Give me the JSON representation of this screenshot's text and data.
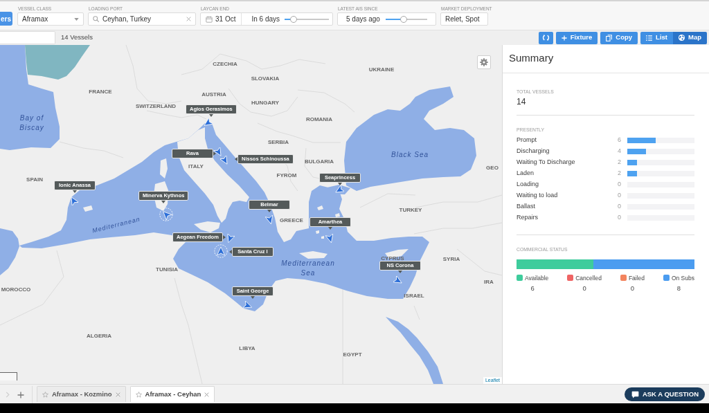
{
  "filters": {
    "toggle": {
      "label": "ers"
    },
    "vessel_class": {
      "label": "VESSEL CLASS",
      "value": "Aframax"
    },
    "loading_port": {
      "label": "LOADING PORT",
      "value": "Ceyhan, Turkey"
    },
    "laycan_end": {
      "label": "LAYCAN END",
      "date": "31 Oct",
      "relative": "In 6 days",
      "level": 0.2
    },
    "latest_ais": {
      "label": "LATEST AIS SINCE",
      "value": "5 days ago",
      "level": 0.44
    },
    "market_deployment": {
      "label": "MARKET DEPLOYMENT",
      "value": "Relet, Spot"
    }
  },
  "toolbar": {
    "vessel_count": "14 Vessels",
    "actions": [
      {
        "kind": "refresh"
      },
      {
        "kind": "add",
        "label": "Fixture"
      },
      {
        "kind": "copy",
        "label": "Copy"
      }
    ],
    "views": [
      {
        "kind": "list",
        "label": "List",
        "selected": false
      },
      {
        "kind": "map",
        "label": "Map",
        "selected": true
      }
    ]
  },
  "map": {
    "labels": [
      {
        "text": "CZECHIA",
        "kind": "country"
      },
      {
        "text": "UKRAINE",
        "kind": "country"
      },
      {
        "text": "SLOVAKIA",
        "kind": "country"
      },
      {
        "text": "FRANCE",
        "kind": "country"
      },
      {
        "text": "AUSTRIA",
        "kind": "country"
      },
      {
        "text": "HUNGARY",
        "kind": "country"
      },
      {
        "text": "SWITZERLAND",
        "kind": "country"
      },
      {
        "text": "Bay of Biscay",
        "kind": "sea"
      },
      {
        "text": "ROMANIA",
        "kind": "country"
      },
      {
        "text": "SERBIA",
        "kind": "country"
      },
      {
        "text": "ITALY",
        "kind": "country"
      },
      {
        "text": "BULGARIA",
        "kind": "country"
      },
      {
        "text": "Black Sea",
        "kind": "sea"
      },
      {
        "text": "FYROM",
        "kind": "country"
      },
      {
        "text": "GEO",
        "kind": "country"
      },
      {
        "text": "SPAIN",
        "kind": "country"
      },
      {
        "text": "TURKEY",
        "kind": "country"
      },
      {
        "text": "GREECE",
        "kind": "country"
      },
      {
        "text": "Mediterranean",
        "kind": "sea"
      },
      {
        "text": "TUNISIA",
        "kind": "country"
      },
      {
        "text": "Mediterranean Sea",
        "kind": "sea"
      },
      {
        "text": "SYRIA",
        "kind": "country"
      },
      {
        "text": "CYPRUS",
        "kind": "country"
      },
      {
        "text": "MOROCCO",
        "kind": "country"
      },
      {
        "text": "ISRAEL",
        "kind": "country"
      },
      {
        "text": "IRA",
        "kind": "country"
      },
      {
        "text": "ALGERIA",
        "kind": "country"
      },
      {
        "text": "LIBYA",
        "kind": "country"
      },
      {
        "text": "EGYPT",
        "kind": "country"
      }
    ],
    "vessels": [
      {
        "name": "Agios Gerasimos",
        "highlighted": false
      },
      {
        "name": "Rava",
        "highlighted": false
      },
      {
        "name": "Nissos Schinoussa",
        "highlighted": false
      },
      {
        "name": "Seaprincess",
        "highlighted": false
      },
      {
        "name": "Ionic Anassa",
        "highlighted": false
      },
      {
        "name": "Minerva Kythnos",
        "highlighted": true
      },
      {
        "name": "Belmar",
        "highlighted": false
      },
      {
        "name": "Amarthea",
        "highlighted": false
      },
      {
        "name": "Aegean Freedom",
        "highlighted": false
      },
      {
        "name": "Santa Cruz I",
        "highlighted": true
      },
      {
        "name": "NS Corona",
        "highlighted": false
      },
      {
        "name": "Saint George",
        "highlighted": false
      }
    ],
    "attribution": "Leaflet"
  },
  "summary": {
    "title": "Summary",
    "total_label": "TOTAL VESSELS",
    "total": "14",
    "presently_label": "PRESENTLY",
    "presently": [
      {
        "name": "Prompt",
        "count": "6",
        "level": 0.42
      },
      {
        "name": "Discharging",
        "count": "4",
        "level": 0.28
      },
      {
        "name": "Waiting To Discharge",
        "count": "2",
        "level": 0.14
      },
      {
        "name": "Laden",
        "count": "2",
        "level": 0.14
      },
      {
        "name": "Loading",
        "count": "0"
      },
      {
        "name": "Waiting to load",
        "count": "0"
      },
      {
        "name": "Ballast",
        "count": "0"
      },
      {
        "name": "Repairs",
        "count": "0"
      }
    ],
    "commercial_label": "COMMERCIAL STATUS",
    "commercial": [
      {
        "name": "Available",
        "count": "6",
        "color": "#3ecc9c",
        "level": 0.43
      },
      {
        "name": "Cancelled",
        "count": "0",
        "color": "#ef6464"
      },
      {
        "name": "Failed",
        "count": "0",
        "color": "#f3845e"
      },
      {
        "name": "On Subs",
        "count": "8",
        "color": "#4b9cf0",
        "level": 0.57
      }
    ]
  },
  "bottom_bar": {
    "scroller": {
      "disabled": true
    },
    "tabs": [
      {
        "label": "Aframax - Kozmino",
        "selected": false
      },
      {
        "label": "Aframax - Ceyhan",
        "selected": true
      }
    ],
    "help_button": "ASK A QUESTION"
  }
}
